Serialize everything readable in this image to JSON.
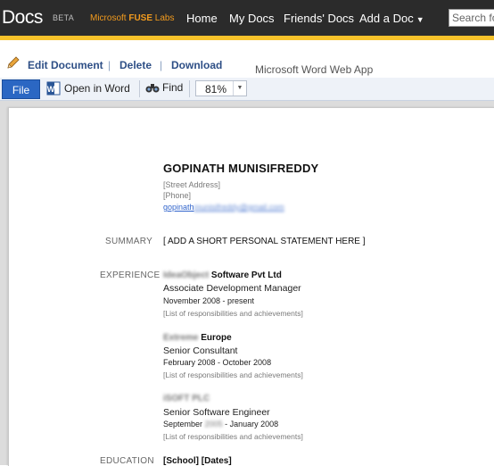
{
  "header": {
    "logo": "Docs",
    "beta": "BETA",
    "fuse_prefix": "Microsoft ",
    "fuse_bold": "FUSE",
    "fuse_suffix": " Labs",
    "nav": [
      "Home",
      "My Docs",
      "Friends' Docs",
      "Add a Doc"
    ],
    "search_placeholder": "Search fo"
  },
  "actions": {
    "edit": "Edit Document",
    "delete": "Delete",
    "download": "Download",
    "app_name": "Microsoft Word Web App"
  },
  "ribbon": {
    "file": "File",
    "open_in_word": "Open in Word",
    "find": "Find",
    "zoom": "81%"
  },
  "resume": {
    "name": "GOPINATH MUNISIFREDDY",
    "street": "[Street Address]",
    "phone": "[Phone]",
    "email_visible": "gopinath",
    "email_blurred": "munisifreddy@gmail.com",
    "summary_label": "SUMMARY",
    "summary_text": "[ ADD A SHORT PERSONAL STATEMENT HERE ]",
    "experience_label": "EXPERIENCE",
    "jobs": [
      {
        "company_blurred": "IdeaObject",
        "company": "Software Pvt Ltd",
        "title": "Associate Development Manager",
        "dates": "November 2008 - present",
        "resp": "[List of responsibilities and achievements]"
      },
      {
        "company_blurred": "Extreme",
        "company": "Europe",
        "title": "Senior Consultant",
        "dates": "February 2008 - October 2008",
        "resp": "[List of responsibilities and achievements]"
      },
      {
        "company_blurred": "iSOFT PLC",
        "company": "",
        "title": "Senior Software Engineer",
        "dates_start": "September",
        "dates_blurred": "2005",
        "dates_end": "- January 2008",
        "resp": "[List of responsibilities and achievements]"
      }
    ],
    "education_label": "EDUCATION",
    "education_text": "[School] [Dates]"
  },
  "colors": {
    "topbar": "#2b2b2b",
    "accent": "#f6c22a",
    "fuse": "#f29b1e",
    "link": "#2e4f86",
    "file_button": "#2b67c3"
  }
}
